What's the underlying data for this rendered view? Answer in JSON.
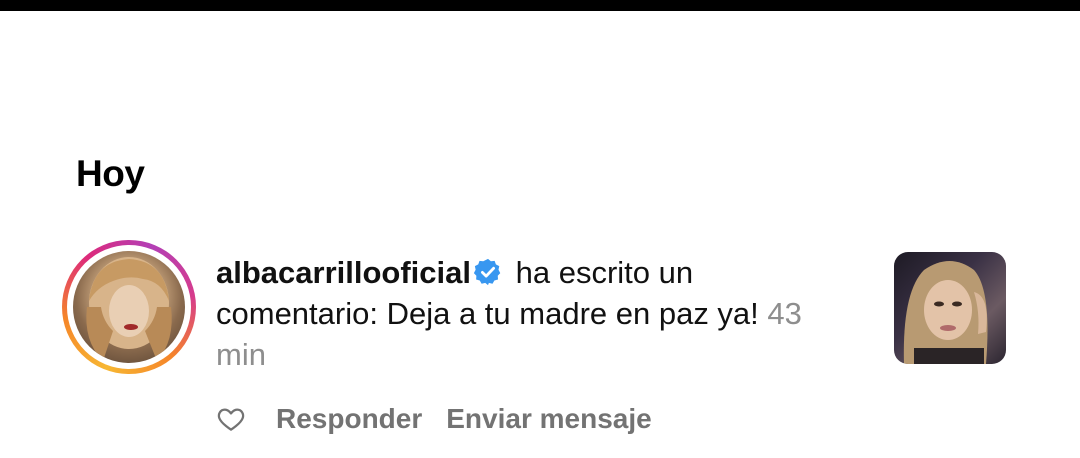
{
  "section": {
    "title": "Hoy"
  },
  "notification": {
    "username": "albacarrillooficial",
    "verified": true,
    "message": "ha escrito un comentario: Deja a tu madre en paz ya!",
    "time": "43 min"
  },
  "actions": {
    "like_icon": "heart-outline-icon",
    "reply_label": "Responder",
    "message_label": "Enviar mensaje"
  },
  "colors": {
    "verified_blue": "#3897f0",
    "muted_text": "#737373",
    "timestamp": "#8e8e8e"
  }
}
